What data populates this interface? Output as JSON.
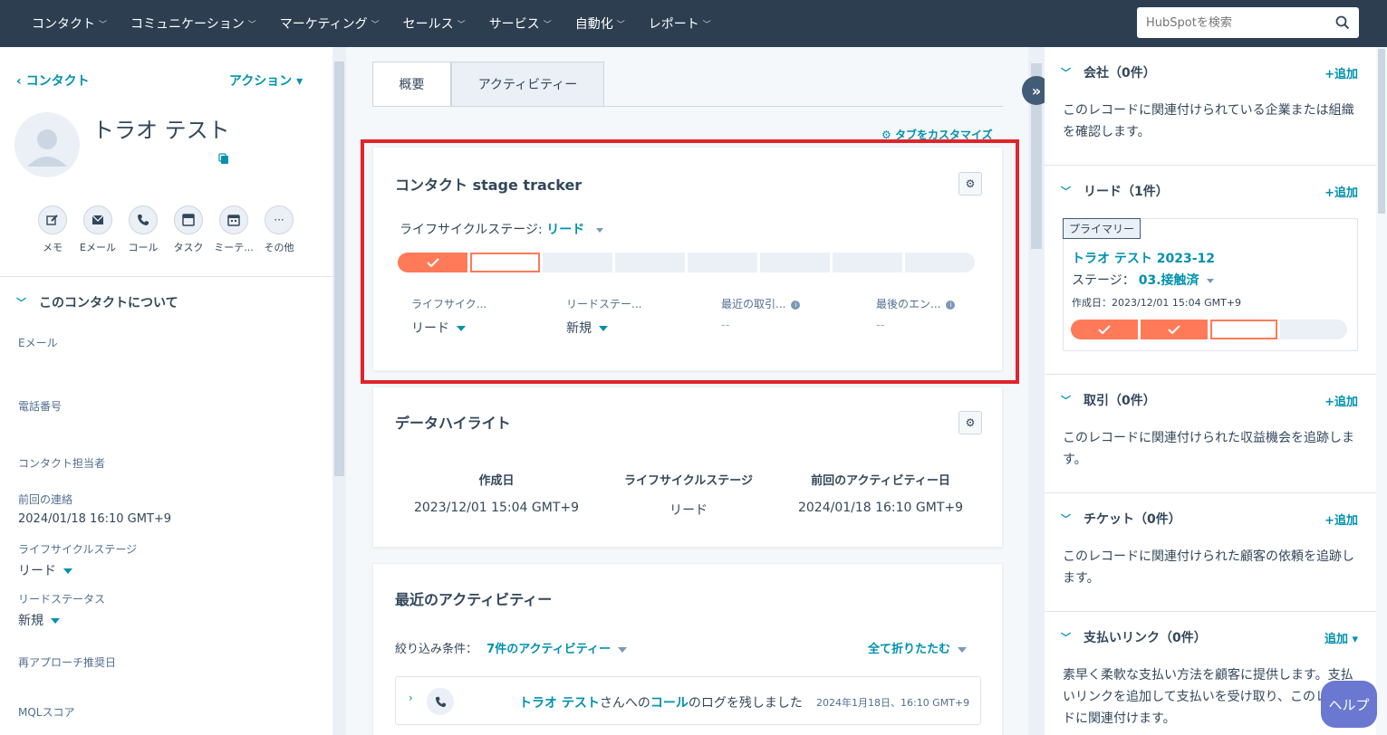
{
  "nav": {
    "items": [
      "コンタクト",
      "コミュニケーション",
      "マーケティング",
      "セールス",
      "サービス",
      "自動化",
      "レポート"
    ],
    "search_placeholder": "HubSpotを検索"
  },
  "left": {
    "back_label": "‹ コンタクト",
    "actions_label": "アクション ▾",
    "contact_name": "トラオ テスト",
    "quick_actions": [
      "メモ",
      "Eメール",
      "コール",
      "タスク",
      "ミーテ...",
      "その他"
    ],
    "about_title": "このコンタクトについて",
    "props": {
      "email_label": "Eメール",
      "phone_label": "電話番号",
      "owner_label": "コンタクト担当者",
      "last_contact_label": "前回の連絡",
      "last_contact_value": "2024/01/18 16:10 GMT+9",
      "lifecycle_label": "ライフサイクルステージ",
      "lifecycle_value": "リード",
      "lead_status_label": "リードステータス",
      "lead_status_value": "新規",
      "reapproach_label": "再アプローチ推奨日",
      "mql_label": "MQLスコア"
    }
  },
  "center": {
    "tabs": [
      "概要",
      "アクティビティー"
    ],
    "customize_label": "タブをカスタマイズ",
    "stage_tracker": {
      "title": "コンタクト stage tracker",
      "lifecycle_prefix": "ライフサイクルステージ:",
      "lifecycle_value": "リード",
      "segments_total": 8,
      "segments_done": 1,
      "columns": [
        {
          "label": "ライフサイク...",
          "value": "リード"
        },
        {
          "label": "リードステー...",
          "value": "新規"
        },
        {
          "label": "最近の取引...",
          "value": "--"
        },
        {
          "label": "最後のエン...",
          "value": "--"
        }
      ]
    },
    "highlights": {
      "title": "データハイライト",
      "columns": [
        {
          "label": "作成日",
          "value": "2023/12/01 15:04 GMT+9"
        },
        {
          "label": "ライフサイクルステージ",
          "value": "リード"
        },
        {
          "label": "前回のアクティビティー日",
          "value": "2024/01/18 16:10 GMT+9"
        }
      ]
    },
    "recent": {
      "title": "最近のアクティビティー",
      "filter_label": "絞り込み条件：",
      "filter_value": "7件のアクティビティー",
      "collapse_all": "全て折りたたむ",
      "item": {
        "name": "トラオ テスト",
        "text1": "さんへの",
        "call": "コール",
        "text2": "のログを残しました",
        "time": "2024年1月18日、16:10 GMT+9"
      }
    }
  },
  "right": {
    "sections": [
      {
        "title": "会社（0件）",
        "add": "+追加",
        "desc": "このレコードに関連付けられている企業または組織を確認します。"
      },
      {
        "title": "リード（1件）",
        "add": "+追加"
      },
      {
        "title": "取引（0件）",
        "add": "+追加",
        "desc": "このレコードに関連付けられた収益機会を追跡します。"
      },
      {
        "title": "チケット（0件）",
        "add": "+追加",
        "desc": "このレコードに関連付けられた顧客の依頼を追跡します。"
      },
      {
        "title": "支払いリンク（0件）",
        "add": "追加 ▾",
        "desc": "素早く柔軟な支払い方法を顧客に提供します。支払いリンクを追加して支払いを受け取り、このレコードに関連付けます。"
      }
    ],
    "lead_card": {
      "badge": "プライマリー",
      "name": "トラオ テスト 2023-12",
      "stage_label": "ステージ：",
      "stage_value": "03.接触済",
      "created": "作成日：2023/12/01 15:04 GMT+9",
      "segments_total": 4,
      "segments_done": 2
    }
  },
  "help_label": "ヘルプ",
  "colors": {
    "accent": "#0091ae",
    "orange": "#ff7a59",
    "nav_bg": "#2d3e50",
    "highlight": "#e0242b"
  }
}
